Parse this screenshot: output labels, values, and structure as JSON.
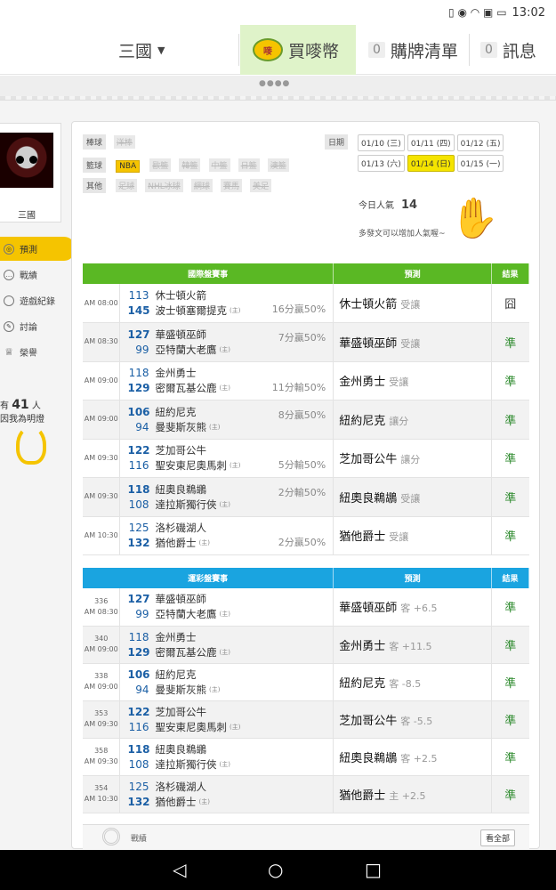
{
  "status": {
    "time": "13:02"
  },
  "nav": {
    "kingdom": "三國",
    "buy": "買嘜幣",
    "coin_text": "嘜",
    "cart_count": "0",
    "cart": "購牌清單",
    "msg_count": "0",
    "msg": "訊息"
  },
  "sidebar": {
    "name": "三國",
    "menu": [
      "預測",
      "戰績",
      "遊戲紀錄",
      "討論",
      "榮譽"
    ],
    "count_prefix": "有",
    "count": "41",
    "count_unit": "人",
    "count_hint": "因我為明燈"
  },
  "filters": {
    "baseball_label": "棒球",
    "baseball": [
      "洋棒"
    ],
    "basketball_label": "籃球",
    "nba": "NBA",
    "basketball": [
      "歐籃",
      "韓籃",
      "中籃",
      "日籃",
      "澳籃"
    ],
    "other_label": "其他",
    "other": [
      "足球",
      "NHL冰球",
      "網球",
      "賽馬",
      "美足"
    ]
  },
  "dates": {
    "label": "日期",
    "row1": [
      "01/10 (三)",
      "01/11 (四)",
      "01/12 (五)"
    ],
    "row2": [
      "01/13 (六)",
      "01/14 (日)",
      "01/15 (一)"
    ]
  },
  "popularity": {
    "label": "今日人氣",
    "value": "14",
    "hint": "多發文可以增加人氣喔~"
  },
  "table1": {
    "headers": [
      "國際盤賽事",
      "預測",
      "結果"
    ],
    "rows": [
      {
        "time": "AM 08:00",
        "n1": "113",
        "t1": "休士頓火箭",
        "n2": "145",
        "t2": "波士頓塞爾提克",
        "spread": "16分贏50%",
        "pick": "休士頓火箭",
        "ptype": "受讓",
        "res": "囧"
      },
      {
        "time": "AM 08:30",
        "n1": "127",
        "t1": "華盛頓巫師",
        "n2": "99",
        "t2": "亞特蘭大老鷹",
        "spread": "7分贏50%",
        "pick": "華盛頓巫師",
        "ptype": "受讓",
        "res": "準"
      },
      {
        "time": "AM 09:00",
        "n1": "118",
        "t1": "金州勇士",
        "n2": "129",
        "t2": "密爾瓦基公鹿",
        "spread": "11分輸50%",
        "pick": "金州勇士",
        "ptype": "受讓",
        "res": "準"
      },
      {
        "time": "AM 09:00",
        "n1": "106",
        "t1": "紐約尼克",
        "n2": "94",
        "t2": "曼斐斯灰熊",
        "spread": "8分贏50%",
        "pick": "紐約尼克",
        "ptype": "讓分",
        "res": "準"
      },
      {
        "time": "AM 09:30",
        "n1": "122",
        "t1": "芝加哥公牛",
        "n2": "116",
        "t2": "聖安東尼奧馬刺",
        "spread": "5分輸50%",
        "pick": "芝加哥公牛",
        "ptype": "讓分",
        "res": "準"
      },
      {
        "time": "AM 09:30",
        "n1": "118",
        "t1": "紐奧良鵜鶘",
        "n2": "108",
        "t2": "達拉斯獨行俠",
        "spread": "2分輸50%",
        "pick": "紐奧良鵜鶘",
        "ptype": "受讓",
        "res": "準"
      },
      {
        "time": "AM 10:30",
        "n1": "125",
        "t1": "洛杉磯湖人",
        "n2": "132",
        "t2": "猶他爵士",
        "spread": "2分贏50%",
        "pick": "猶他爵士",
        "ptype": "受讓",
        "res": "準"
      }
    ]
  },
  "table2": {
    "headers": [
      "運彩盤賽事",
      "預測",
      "結果"
    ],
    "rows": [
      {
        "id": "336",
        "time": "AM 08:30",
        "n1": "127",
        "t1": "華盛頓巫師",
        "n2": "99",
        "t2": "亞特蘭大老鷹",
        "pick": "華盛頓巫師",
        "ptype": "客 +6.5",
        "res": "準"
      },
      {
        "id": "340",
        "time": "AM 09:00",
        "n1": "118",
        "t1": "金州勇士",
        "n2": "129",
        "t2": "密爾瓦基公鹿",
        "pick": "金州勇士",
        "ptype": "客 +11.5",
        "res": "準"
      },
      {
        "id": "338",
        "time": "AM 09:00",
        "n1": "106",
        "t1": "紐約尼克",
        "n2": "94",
        "t2": "曼斐斯灰熊",
        "pick": "紐約尼克",
        "ptype": "客 -8.5",
        "res": "準"
      },
      {
        "id": "353",
        "time": "AM 09:30",
        "n1": "122",
        "t1": "芝加哥公牛",
        "n2": "116",
        "t2": "聖安東尼奧馬刺",
        "pick": "芝加哥公牛",
        "ptype": "客 -5.5",
        "res": "準"
      },
      {
        "id": "358",
        "time": "AM 09:30",
        "n1": "118",
        "t1": "紐奧良鵜鶘",
        "n2": "108",
        "t2": "達拉斯獨行俠",
        "pick": "紐奧良鵜鶘",
        "ptype": "客 +2.5",
        "res": "準"
      },
      {
        "id": "354",
        "time": "AM 10:30",
        "n1": "125",
        "t1": "洛杉磯湖人",
        "n2": "132",
        "t2": "猶他爵士",
        "pick": "猶他爵士",
        "ptype": "主 +2.5",
        "res": "準"
      }
    ]
  },
  "record": {
    "label": "戰績",
    "all": "看全部"
  },
  "home_mark": "(主)",
  "colors": {
    "green": "#5ab824",
    "blue": "#1aa4e0",
    "yellow": "#f5c400"
  }
}
